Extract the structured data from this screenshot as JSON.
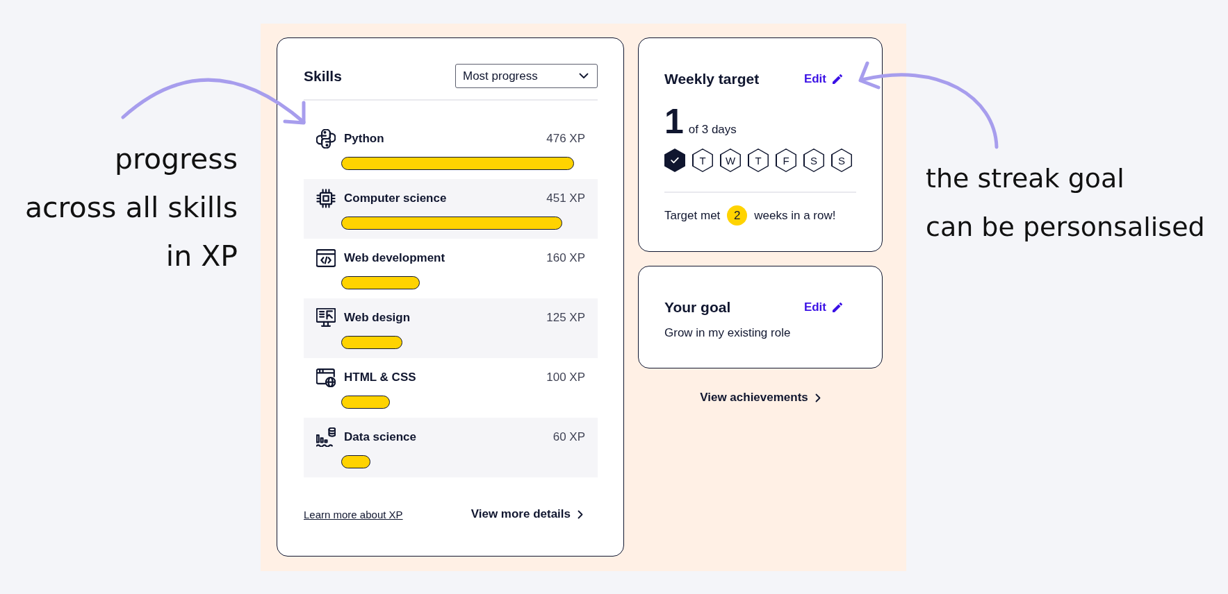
{
  "left_note": {
    "lines": [
      "progress",
      "across all skills",
      "in XP"
    ]
  },
  "skills": {
    "title": "Skills",
    "sort": {
      "value": "Most progress"
    },
    "items": [
      {
        "name": "Python",
        "xp": "476 XP",
        "level": 0.952
      },
      {
        "name": "Computer science",
        "xp": "451 XP",
        "level": 0.902
      },
      {
        "name": "Web development",
        "xp": "160 XP",
        "level": 0.32
      },
      {
        "name": "Web design",
        "xp": "125 XP",
        "level": 0.25
      },
      {
        "name": "HTML & CSS",
        "xp": "100 XP",
        "level": 0.2
      },
      {
        "name": "Data science",
        "xp": "60 XP",
        "level": 0.12
      }
    ],
    "learn_more": "Learn more about XP",
    "view_details": "View more details"
  },
  "weekly_target": {
    "title": "Weekly target",
    "edit": "Edit",
    "count": "1",
    "goal": "of 3 days",
    "days": [
      {
        "completed": true
      },
      {
        "label": "T",
        "completed": false
      },
      {
        "label": "W",
        "completed": false
      },
      {
        "label": "T",
        "completed": false
      },
      {
        "label": "F",
        "completed": false
      },
      {
        "label": "S",
        "completed": false
      },
      {
        "label": "S",
        "completed": false
      }
    ],
    "streak": {
      "before": "Target met",
      "count": "2",
      "after": "weeks in a row!"
    }
  },
  "goal": {
    "title": "Your goal",
    "edit": "Edit",
    "text": "Grow in my existing role"
  },
  "view_achievements": "View achievements",
  "right_note": {
    "lines": [
      "the streak goal",
      "can be personsalised"
    ]
  }
}
